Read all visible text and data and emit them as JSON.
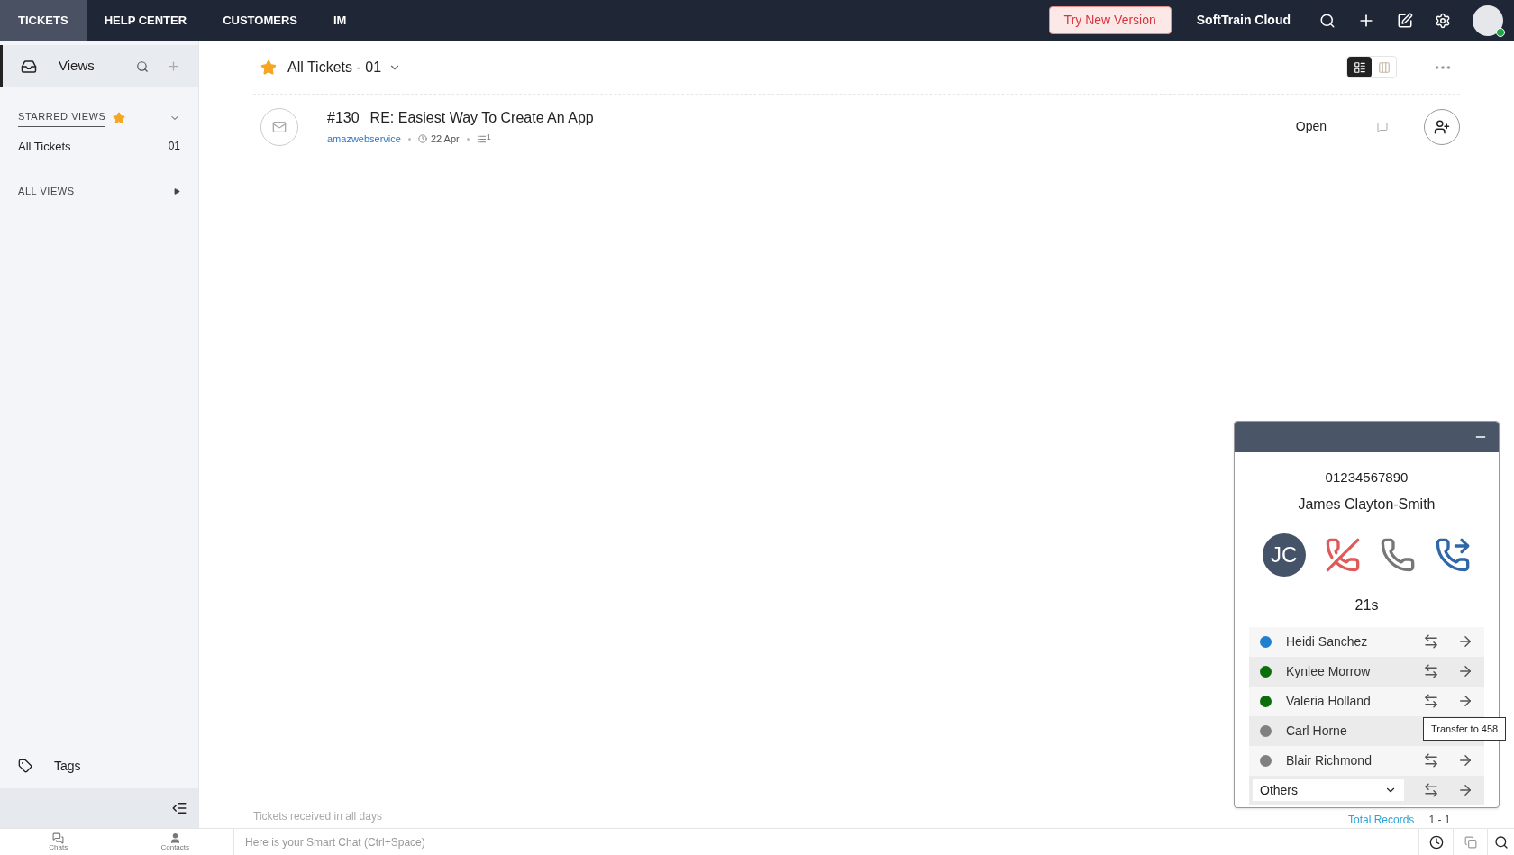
{
  "top_nav": {
    "tabs": [
      {
        "label": "TICKETS",
        "selected": true
      },
      {
        "label": "HELP CENTER",
        "selected": false
      },
      {
        "label": "CUSTOMERS",
        "selected": false
      },
      {
        "label": "IM",
        "selected": false
      }
    ],
    "try_button": "Try New Version",
    "org": "SoftTrain Cloud",
    "user_online": true
  },
  "sidebar": {
    "title": "Views",
    "starred_label": "STARRED VIEWS",
    "starred_items": [
      {
        "label": "All Tickets",
        "count": "01"
      }
    ],
    "all_views_label": "ALL VIEWS",
    "tags_label": "Tags"
  },
  "view": {
    "title": "All Tickets - 01",
    "starred": true,
    "layouts": [
      {
        "kind": "list",
        "selected": true
      },
      {
        "kind": "board",
        "selected": false
      }
    ]
  },
  "tickets": [
    {
      "number": "#130",
      "subject": "RE: Easiest Way To Create An App",
      "contact": "amazwebservice",
      "date": "22 Apr",
      "thread_count": "1",
      "status": "Open"
    }
  ],
  "footer_note": "Tickets received in all days",
  "total_label": "Total Records",
  "total_range": "1 - 1",
  "call": {
    "number": "01234567890",
    "name": "James Clayton-Smith",
    "initials": "JC",
    "duration": "21s",
    "agents": [
      {
        "name": "Heidi Sanchez",
        "color": "#1f7fd0"
      },
      {
        "name": "Kynlee Morrow",
        "color": "#0b6e0b"
      },
      {
        "name": "Valeria Holland",
        "color": "#0b6e0b"
      },
      {
        "name": "Carl Horne",
        "color": "#808080",
        "tooltip": "Transfer to 458"
      },
      {
        "name": "Blair Richmond",
        "color": "#808080"
      }
    ],
    "others": "Others"
  },
  "bottom_bar": {
    "nav": [
      {
        "label": "Chats",
        "kind": "chats"
      },
      {
        "label": "Contacts",
        "kind": "contacts"
      }
    ],
    "smart_chat_placeholder": "Here is your Smart Chat (Ctrl+Space)"
  }
}
